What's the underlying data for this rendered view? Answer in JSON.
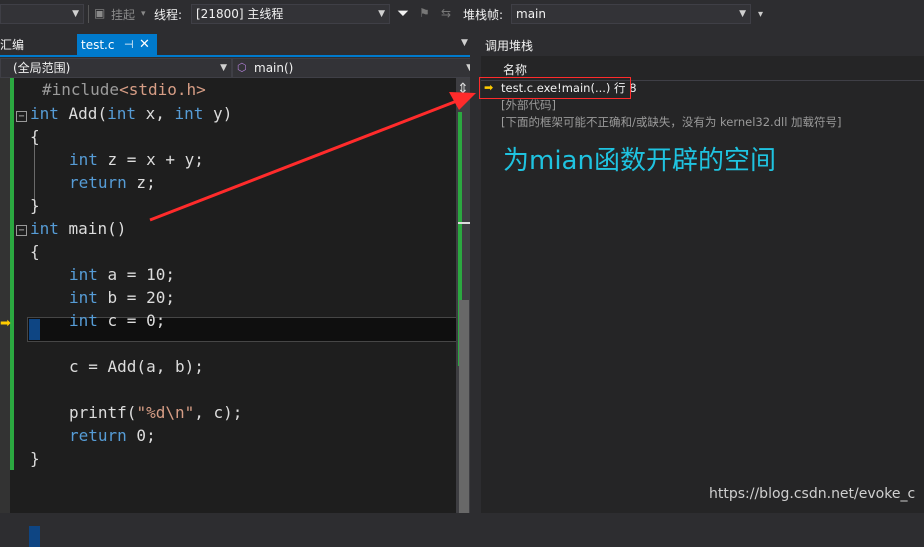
{
  "toolbar": {
    "suspend_label": "挂起",
    "thread_label": "线程:",
    "thread_value": "[21800] 主线程",
    "stackframe_label": "堆栈帧:",
    "stackframe_value": "main",
    "icons": [
      "suspend-icon",
      "filter-icon",
      "flag-icon",
      "overflow-icon"
    ]
  },
  "editor": {
    "left_tab_label": "反汇编",
    "active_tab": {
      "name": "test.c",
      "pin_glyph": "⊣",
      "close_glyph": "✕"
    },
    "scope": "(全局范围)",
    "function": "main()",
    "lines": [
      {
        "prefix": "#include",
        "rest": "<stdio.h>"
      },
      {
        "kw1": "int",
        "t1": " Add(",
        "kw2": "int",
        "t2": " x, ",
        "kw3": "int",
        "t3": " y)"
      },
      {
        "text": "{"
      },
      {
        "kw": "int",
        "rest": " z = x + y;"
      },
      {
        "kw": "return",
        "rest": " z;"
      },
      {
        "text": "}"
      },
      {
        "kw": "int",
        "rest": " main()"
      },
      {
        "text": "{"
      },
      {
        "kw": "int",
        "rest": " a = 10;"
      },
      {
        "kw": "int",
        "rest": " b = 20;"
      },
      {
        "kw": "int",
        "rest": " c = 0;"
      },
      {
        "text": "c = Add(a, b);"
      },
      {
        "fn": "printf(",
        "str": "\"%d\\n\"",
        "rest": ", c);"
      },
      {
        "kw": "return",
        "rest": " 0;"
      },
      {
        "text": "}"
      }
    ]
  },
  "callstack": {
    "title": "调用堆栈",
    "column": "名称",
    "frames": [
      "test.c.exe!main(...) 行 8",
      "[外部代码]",
      "[下面的框架可能不正确和/或缺失，没有为 kernel32.dll 加载符号]"
    ]
  },
  "annotation": "为mian函数开辟的空间",
  "watermark": "https://blog.csdn.net/evoke_c",
  "colors": {
    "accent": "#007acc",
    "keyword": "#569cd6",
    "string": "#d69d85",
    "annotation": "#1fc3e0",
    "arrow": "#ff2b2b",
    "changebar": "#2ba840"
  }
}
